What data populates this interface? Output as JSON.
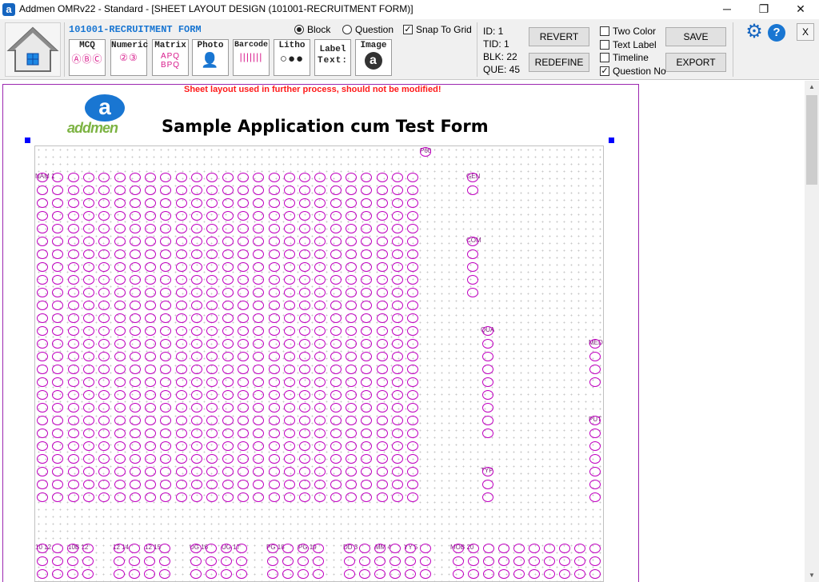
{
  "window": {
    "title": "Addmen OMRv22 - Standard - [SHEET LAYOUT DESIGN (101001-RECRUITMENT FORM)]",
    "app_icon_letter": "a",
    "minimize": "─",
    "maximize": "❐",
    "close": "✕"
  },
  "toolbar": {
    "form_name": "101001-RECRUITMENT FORM",
    "tools": [
      {
        "label": "MCQ",
        "icon": "ⒶⒷⒸ"
      },
      {
        "label": "Numeric",
        "icon": "②③"
      },
      {
        "label": "Matrix",
        "icon": "APQ BPQ"
      },
      {
        "label": "Photo",
        "icon": "👤"
      },
      {
        "label": "Barcode",
        "icon": "|||||||"
      },
      {
        "label": "Litho",
        "icon": "○●●"
      },
      {
        "label": "Label",
        "icon": "Text:"
      },
      {
        "label": "Image",
        "icon": "a"
      }
    ],
    "radio_block": "Block",
    "radio_question": "Question",
    "snap_to_grid": "Snap To Grid",
    "selected_mode": "Block",
    "snap_checked": true
  },
  "info": {
    "id": "ID: 1",
    "tid": "TID: 1",
    "blk": "BLK: 22",
    "que": "QUE: 45"
  },
  "buttons": {
    "revert": "REVERT",
    "redefine": "REDEFINE",
    "save": "SAVE",
    "export": "EXPORT",
    "close_panel": "X"
  },
  "options": {
    "two_color": {
      "label": "Two Color",
      "checked": false
    },
    "text_label": {
      "label": "Text Label",
      "checked": false
    },
    "timeline": {
      "label": "Timeline",
      "checked": false
    },
    "question_no": {
      "label": "Question No",
      "checked": true
    }
  },
  "sheet": {
    "warning": "Sheet layout used in further process, should not be modified!",
    "logo_letter": "a",
    "logo_word": "addmen",
    "title": "Sample Application cum Test Form",
    "accent_color": "#c000c0",
    "field_labels": {
      "name": "NAM 1",
      "photo": "P60",
      "gender": "GEN",
      "community": "COM",
      "qualification": "QUA",
      "medium": "MED",
      "post": "PUT",
      "type": "TYP",
      "row_fields": [
        "10 12",
        "10B 12",
        "12 14",
        "12 15",
        "UG 16",
        "UG 17",
        "PG 18",
        "PG 19",
        "DD 3",
        "MM 4",
        "YY 5",
        "MOB 20"
      ]
    }
  },
  "icons": {
    "home": "home-icon",
    "settings": "gear-icon",
    "help": "help-icon"
  }
}
